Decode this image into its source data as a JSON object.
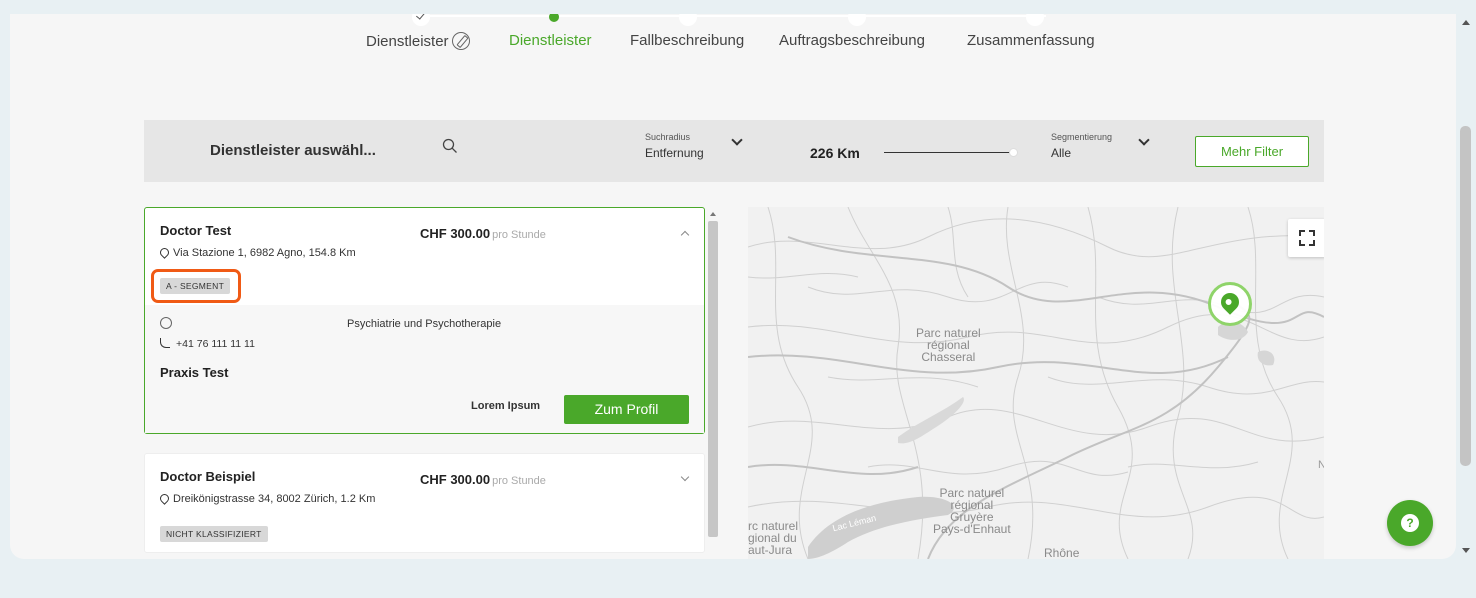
{
  "stepper": {
    "steps": [
      {
        "label": "Dienstleister",
        "state": "done"
      },
      {
        "label": "Dienstleister",
        "state": "active"
      },
      {
        "label": "Fallbeschreibung",
        "state": "pending"
      },
      {
        "label": "Auftragsbeschreibung",
        "state": "pending"
      },
      {
        "label": "Zusammenfassung",
        "state": "pending"
      }
    ]
  },
  "filter": {
    "search_placeholder": "Dienstleister auswähl...",
    "radius_label": "Suchradius",
    "radius_value": "Entfernung",
    "distance_value": "226 Km",
    "distance_slider_level": 1.0,
    "segment_label": "Segmentierung",
    "segment_value": "Alle",
    "more_filter_label": "Mehr Filter"
  },
  "results": [
    {
      "name": "Doctor Test",
      "price": "CHF 300.00",
      "price_unit": "pro Stunde",
      "address": "Via Stazione 1, 6982 Agno, 154.8 Km",
      "segment": "A - SEGMENT",
      "expanded": true,
      "specialty": "Psychiatrie und Psychotherapie",
      "phone": "+41 76 111 11 11",
      "practice": "Praxis Test",
      "secondary_text": "Lorem Ipsum",
      "profile_button": "Zum Profil"
    },
    {
      "name": "Doctor Beispiel",
      "price": "CHF 300.00",
      "price_unit": "pro Stunde",
      "address": "Dreikönigstrasse 34, 8002 Zürich, 1.2 Km",
      "segment": "NICHT KLASSIFIZIERT",
      "expanded": false
    }
  ],
  "map": {
    "labels": {
      "chasseral": "Parc naturel\nrégional\nChasseral",
      "gruyere": "Parc naturel\nrégional\nGruyère\nPays-d'Enhaut",
      "jura": "rc naturel\ngional du\naut-Jura",
      "leman": "Lac Léman",
      "rhone": "Rhône",
      "edge_n": "N"
    }
  },
  "colors": {
    "accent": "#4aa82a",
    "highlight": "#f05a15"
  },
  "icons": {
    "help": "?"
  }
}
